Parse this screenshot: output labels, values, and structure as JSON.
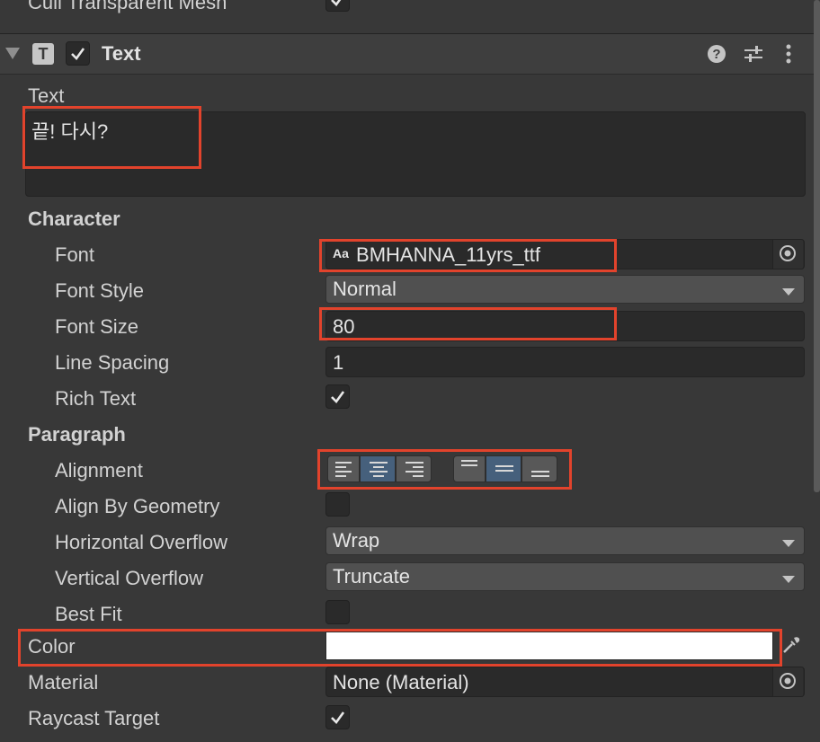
{
  "prev_component": {
    "label": "Cull Transparent Mesh",
    "checked": true
  },
  "header": {
    "title": "Text",
    "component_icon": "T",
    "enabled": true,
    "icons": [
      "help-icon",
      "presets-icon",
      "more-icon"
    ]
  },
  "text_field": {
    "label": "Text",
    "value": "끝! 다시?"
  },
  "character": {
    "heading": "Character",
    "font": {
      "label": "Font",
      "icon_text": "Aa",
      "value": "BMHANNA_11yrs_ttf"
    },
    "font_style": {
      "label": "Font Style",
      "value": "Normal"
    },
    "font_size": {
      "label": "Font Size",
      "value": "80"
    },
    "line_spacing": {
      "label": "Line Spacing",
      "value": "1"
    },
    "rich_text": {
      "label": "Rich Text",
      "checked": true
    }
  },
  "paragraph": {
    "heading": "Paragraph",
    "alignment": {
      "label": "Alignment",
      "horizontal_selected": "center",
      "vertical_selected": "middle"
    },
    "align_by_geometry": {
      "label": "Align By Geometry",
      "checked": false
    },
    "horizontal_overflow": {
      "label": "Horizontal Overflow",
      "value": "Wrap"
    },
    "vertical_overflow": {
      "label": "Vertical Overflow",
      "value": "Truncate"
    },
    "best_fit": {
      "label": "Best Fit",
      "checked": false
    }
  },
  "color": {
    "label": "Color",
    "value": "#ffffff"
  },
  "material": {
    "label": "Material",
    "value": "None (Material)"
  },
  "raycast_target": {
    "label": "Raycast Target",
    "checked": true
  },
  "colors": {
    "highlight": "#e2432c",
    "selected_segment": "#46607c"
  }
}
